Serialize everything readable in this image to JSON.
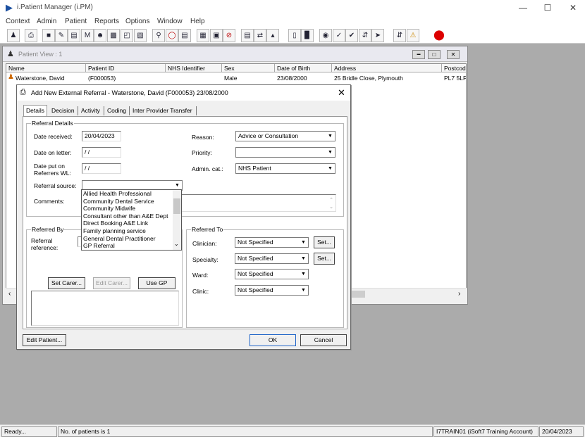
{
  "app": {
    "title": "i.Patient Manager (i.PM)"
  },
  "window_controls": {
    "minimize": "—",
    "maximize": "☐",
    "close": "✕"
  },
  "menu": [
    "Context",
    "Admin",
    "Patient",
    "Reports",
    "Options",
    "Window",
    "Help"
  ],
  "patient_view": {
    "title": "Patient View : 1",
    "columns": [
      "Name",
      "Patient ID",
      "NHS Identifier",
      "Sex",
      "Date of Birth",
      "Address",
      "Postcod"
    ],
    "row": [
      "Waterstone, David",
      "(F000053)",
      "",
      "Male",
      "23/08/2000",
      "25 Bridle Close, Plymouth",
      "PL7 5LF"
    ]
  },
  "dialog": {
    "title": "Add New External Referral - Waterstone, David (F000053) 23/08/2000",
    "tabs": [
      "Details",
      "Decision",
      "Activity",
      "Coding",
      "Inter Provider Transfer"
    ],
    "referral_details": {
      "group_label": "Referral Details",
      "date_received_label": "Date received:",
      "date_received": "20/04/2023",
      "date_on_letter_label": "Date on letter:",
      "date_on_letter": "/ /",
      "date_put_on_label_1": "Date put on",
      "date_put_on_label_2": "Referrers WL:",
      "date_put_on": "/ /",
      "referral_source_label": "Referral source:",
      "referral_source": "",
      "comments_label": "Comments:",
      "reason_label": "Reason:",
      "reason": "Advice or Consultation",
      "priority_label": "Priority:",
      "priority": "",
      "admin_cat_label": "Admin. cat.:",
      "admin_cat": "NHS Patient"
    },
    "referral_source_options": [
      "Allied Health Professional",
      "Community Dental Service",
      "Community Midwife",
      "Consultant other than A&E Dept",
      "Direct Booking A&E Link",
      "Family planning service",
      "General Dental Practitioner",
      "GP Referral"
    ],
    "referred_by": {
      "group_label": "Referred By",
      "referral_ref_label_1": "Referral",
      "referral_ref_label_2": "reference:",
      "set_carer": "Set Carer...",
      "edit_carer": "Edit Carer...",
      "use_gp": "Use GP"
    },
    "referred_to": {
      "group_label": "Referred To",
      "clinician_label": "Clinician:",
      "clinician": "Not Specified",
      "specialty_label": "Specialty:",
      "specialty": "Not Specified",
      "ward_label": "Ward:",
      "ward": "Not Specified",
      "clinic_label": "Clinic:",
      "clinic": "Not Specified",
      "set_label": "Set..."
    },
    "edit_patient": "Edit Patient...",
    "ok": "OK",
    "cancel": "Cancel"
  },
  "status": {
    "ready": "Ready...",
    "patients": "No. of patients is 1",
    "user": "I7TRAIN01 (iSoft7 Training Account)",
    "date": "20/04/2023"
  }
}
